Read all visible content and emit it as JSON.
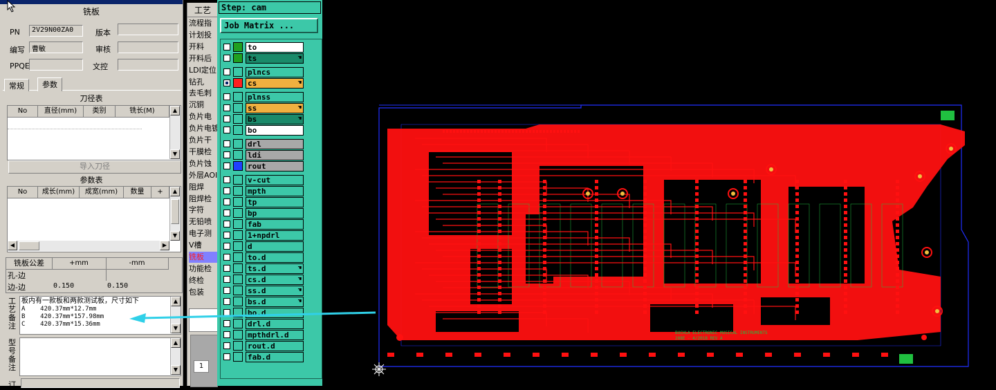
{
  "left_panel": {
    "title": "铣板",
    "fields": [
      {
        "label": "PN",
        "value": "2V29N00ZA0"
      },
      {
        "label": "版本",
        "value": ""
      },
      {
        "label": "编写",
        "value": "曹敏"
      },
      {
        "label": "审核",
        "value": ""
      },
      {
        "label": "PPQE",
        "value": ""
      },
      {
        "label": "文控",
        "value": ""
      }
    ],
    "tabs": [
      "常规",
      "参数"
    ],
    "tool_table": {
      "title": "刀径表",
      "headers": [
        "No",
        "直径(mm)",
        "类别",
        "铣长(M)"
      ],
      "import_button": "导入刀径"
    },
    "param_table": {
      "title": "参数表",
      "headers": [
        "No",
        "成长(mm)",
        "成宽(mm)",
        "数量",
        "+"
      ]
    },
    "tolerance_table": {
      "headers": [
        "铣板公差",
        "+mm",
        "-mm"
      ],
      "rows": [
        {
          "name": "孔-边",
          "plus": "",
          "minus": ""
        },
        {
          "name": "边-边",
          "plus": "0.150",
          "minus": "0.150"
        }
      ]
    },
    "process_note_label": "工艺备注",
    "process_note_lines": [
      "板内有一款板和两款测试板，尺寸如下",
      "A    420.37mm*12.7mm",
      "B    420.37mm*157.98mm",
      "C    420.37mm*15.36mm"
    ],
    "model_note_label": "型号备注",
    "bottom_label": "订"
  },
  "process_column": {
    "title": "工艺",
    "items": [
      "流程指",
      "计划投",
      "开料",
      "开料后",
      "LDI定位",
      "钻孔",
      "去毛刺",
      "沉铜",
      "负片电",
      "负片电镀",
      "负片干",
      "干膜检",
      "负片蚀",
      "外层AOI",
      "阻焊",
      "阻焊检",
      "字符",
      "无铅喷",
      "电子测",
      "V槽",
      "铣板",
      "功能检",
      "终检",
      "包装"
    ],
    "selected": "铣板",
    "page_number": "1"
  },
  "matrix": {
    "step_label": "Step: cam",
    "job_matrix_button": "Job Matrix ...",
    "layers": [
      {
        "name": "to",
        "color": "#ffffff",
        "swatch": "#20a020",
        "active": false,
        "hand": false
      },
      {
        "name": "ts",
        "color": "#1a8a6a",
        "swatch": "#20a020",
        "active": false,
        "hand": true
      },
      {
        "name": "plncs",
        "color": "#3cc8a8",
        "swatch": "",
        "active": false,
        "hand": false
      },
      {
        "name": "cs",
        "color": "#f0b040",
        "swatch": "#ff2020",
        "active": true,
        "hand": true
      },
      {
        "name": "plnss",
        "color": "#3cc8a8",
        "swatch": "",
        "active": false,
        "hand": false
      },
      {
        "name": "ss",
        "color": "#f0b040",
        "swatch": "",
        "active": false,
        "hand": true
      },
      {
        "name": "bs",
        "color": "#1a8a6a",
        "swatch": "",
        "active": false,
        "hand": true
      },
      {
        "name": "bo",
        "color": "#ffffff",
        "swatch": "",
        "active": false,
        "hand": false
      },
      {
        "name": "drl",
        "color": "#a8a8a8",
        "swatch": "",
        "active": false,
        "hand": false
      },
      {
        "name": "ldi",
        "color": "#a8a8a8",
        "swatch": "",
        "active": false,
        "hand": false
      },
      {
        "name": "rout",
        "color": "#a8a8a8",
        "swatch": "#2040ff",
        "active": false,
        "hand": false
      },
      {
        "name": "v-cut",
        "color": "#3cc8a8",
        "swatch": "",
        "active": false,
        "hand": false
      },
      {
        "name": "mpth",
        "color": "#3cc8a8",
        "swatch": "",
        "active": false,
        "hand": false
      },
      {
        "name": "tp",
        "color": "#3cc8a8",
        "swatch": "",
        "active": false,
        "hand": false
      },
      {
        "name": "bp",
        "color": "#3cc8a8",
        "swatch": "",
        "active": false,
        "hand": false
      },
      {
        "name": "fab",
        "color": "#3cc8a8",
        "swatch": "",
        "active": false,
        "hand": false
      },
      {
        "name": "1+npdrl",
        "color": "#3cc8a8",
        "swatch": "",
        "active": false,
        "hand": false
      },
      {
        "name": "d",
        "color": "#3cc8a8",
        "swatch": "",
        "active": false,
        "hand": false
      },
      {
        "name": "to.d",
        "color": "#3cc8a8",
        "swatch": "",
        "active": false,
        "hand": false
      },
      {
        "name": "ts.d",
        "color": "#3cc8a8",
        "swatch": "",
        "active": false,
        "hand": true
      },
      {
        "name": "cs.d",
        "color": "#3cc8a8",
        "swatch": "",
        "active": false,
        "hand": true
      },
      {
        "name": "ss.d",
        "color": "#3cc8a8",
        "swatch": "",
        "active": false,
        "hand": true
      },
      {
        "name": "bs.d",
        "color": "#3cc8a8",
        "swatch": "",
        "active": false,
        "hand": true
      },
      {
        "name": "bo.d",
        "color": "#3cc8a8",
        "swatch": "",
        "active": false,
        "hand": false
      },
      {
        "name": "drl.d",
        "color": "#3cc8a8",
        "swatch": "",
        "active": false,
        "hand": false
      },
      {
        "name": "mpthdrl.d",
        "color": "#3cc8a8",
        "swatch": "",
        "active": false,
        "hand": false
      },
      {
        "name": "rout.d",
        "color": "#3cc8a8",
        "swatch": "",
        "active": false,
        "hand": false
      },
      {
        "name": "fab.d",
        "color": "#3cc8a8",
        "swatch": "",
        "active": false,
        "hand": false
      }
    ]
  },
  "pcb": {
    "silk_text_1": "BUCHLA ELECTRONIC MUSICAL INSTRUMENTS",
    "silk_text_2": "288E - 4/2018  REV A",
    "colors": {
      "copper": "#ff1010",
      "outline": "#2030ff",
      "silk": "#20c040",
      "background": "#000000"
    }
  },
  "accent": {
    "arrow": "#30d0e8"
  }
}
